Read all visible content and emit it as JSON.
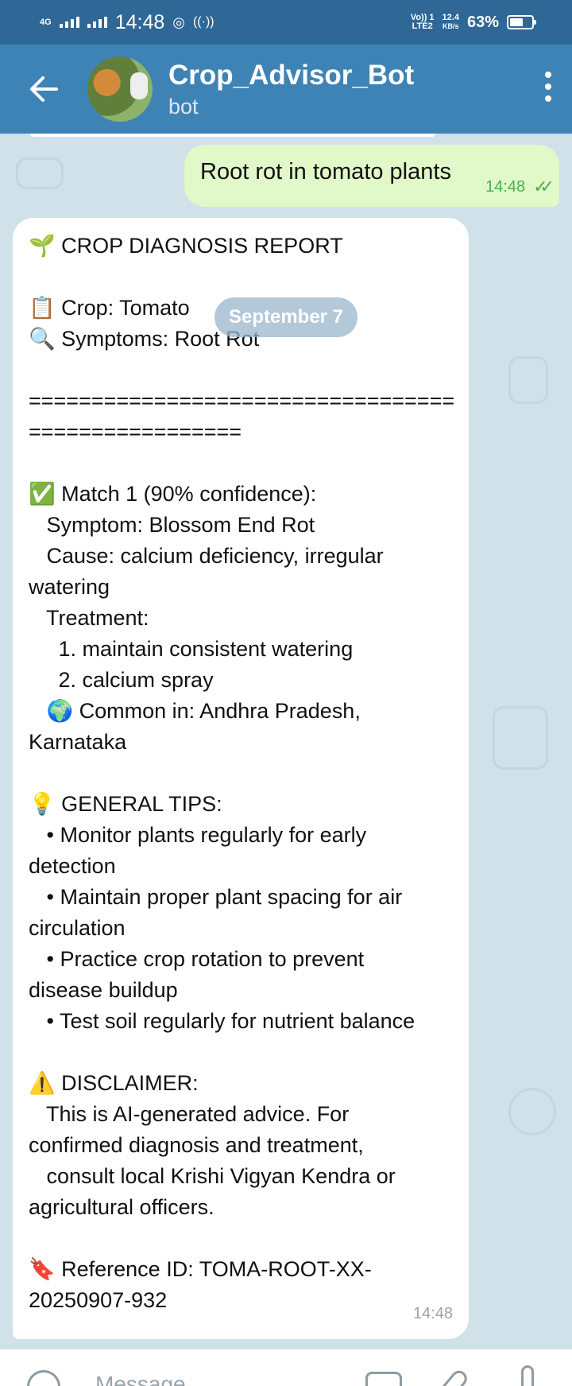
{
  "status_bar": {
    "network": "4G",
    "time": "14:48",
    "volte": "Vo)) 1",
    "lte": "LTE2",
    "speed_value": "12.4",
    "speed_unit": "KB/s",
    "battery_percent": "63%",
    "battery_level": 0.63
  },
  "header": {
    "back_icon": "arrow-left-icon",
    "title": "Crop_Advisor_Bot",
    "subtitle": "bot",
    "menu_icon": "more-vertical-icon"
  },
  "outgoing_message": {
    "text": "Root rot in tomato plants",
    "time": "14:48",
    "status_icon": "double-check-icon"
  },
  "date_pill": "September 7",
  "incoming_message": {
    "lines": [
      "🌱 CROP DIAGNOSIS REPORT",
      "",
      "📋 Crop: Tomato",
      "🔍 Symptoms: Root Rot",
      "",
      "==================================",
      "=================",
      "",
      "✅ Match 1 (90% confidence):",
      "   Symptom: Blossom End Rot",
      "   Cause: calcium deficiency, irregular",
      "watering",
      "   Treatment:",
      "     1. maintain consistent watering",
      "     2. calcium spray",
      "   🌍 Common in: Andhra Pradesh,",
      "Karnataka",
      "",
      "💡 GENERAL TIPS:",
      "   • Monitor plants regularly for early",
      "detection",
      "   • Maintain proper plant spacing for air",
      "circulation",
      "   • Practice crop rotation to prevent",
      "disease buildup",
      "   • Test soil regularly for nutrient balance",
      "",
      "⚠️ DISCLAIMER:",
      "   This is AI-generated advice. For",
      "confirmed diagnosis and treatment,",
      "   consult local Krishi Vigyan Kendra or",
      "agricultural officers.",
      "",
      "🔖 Reference ID: TOMA-ROOT-XX-",
      "20250907-932"
    ],
    "time": "14:48"
  },
  "input_bar": {
    "placeholder": "Message",
    "emoji_icon": "smile-icon",
    "camera_icon": "camera-icon",
    "attach_icon": "paperclip-icon",
    "mic_icon": "microphone-icon"
  },
  "colors": {
    "header": "#3e83b6",
    "status_bar": "#2f6796",
    "outgoing_bubble": "#e1f8c9",
    "incoming_bubble": "#ffffff",
    "chat_background": "#d0e1ea",
    "check_color": "#4fae4e"
  }
}
